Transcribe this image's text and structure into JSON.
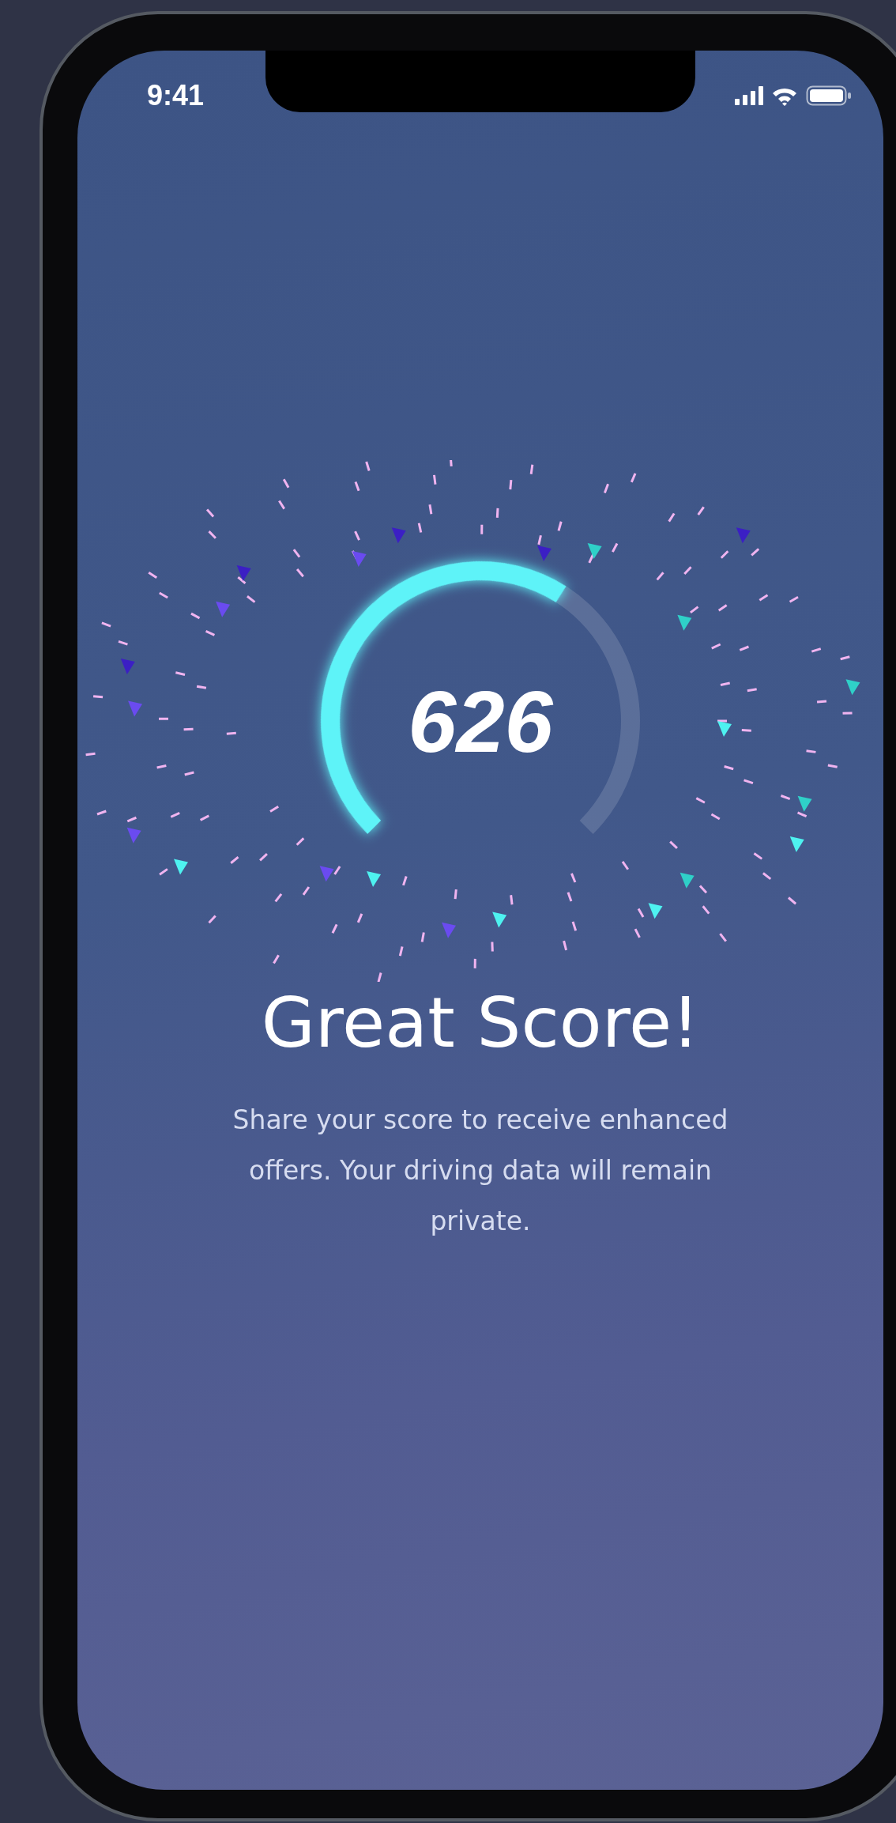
{
  "status_bar": {
    "time": "9:41"
  },
  "score": {
    "value": "626",
    "level": 0.62
  },
  "title": "Great Score!",
  "message": "Share your score to receive enhanced offers. Your driving data will remain private."
}
